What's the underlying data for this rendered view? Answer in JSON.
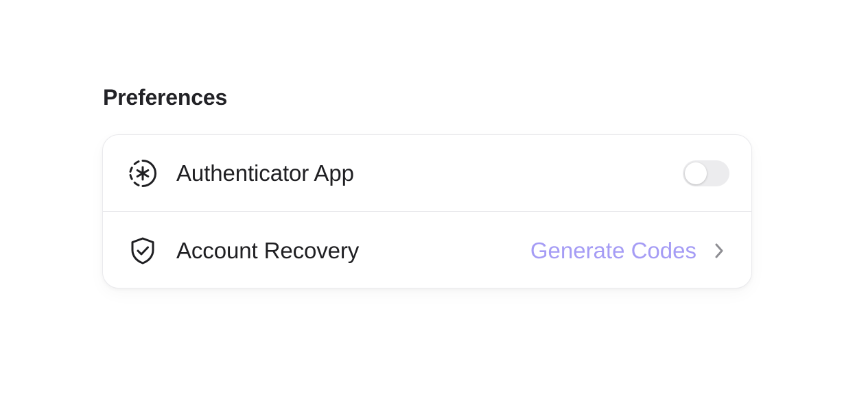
{
  "section": {
    "title": "Preferences"
  },
  "items": [
    {
      "icon": "dashed-circle-asterisk-icon",
      "label": "Authenticator App",
      "control": "toggle",
      "enabled": false
    },
    {
      "icon": "shield-check-icon",
      "label": "Account Recovery",
      "action_label": "Generate Codes",
      "trailing_icon": "chevron-right-icon"
    }
  ],
  "colors": {
    "text": "#1f1f22",
    "accent": "#a59cf5",
    "toggle_off": "#ececee",
    "chevron": "#8e8e93"
  }
}
